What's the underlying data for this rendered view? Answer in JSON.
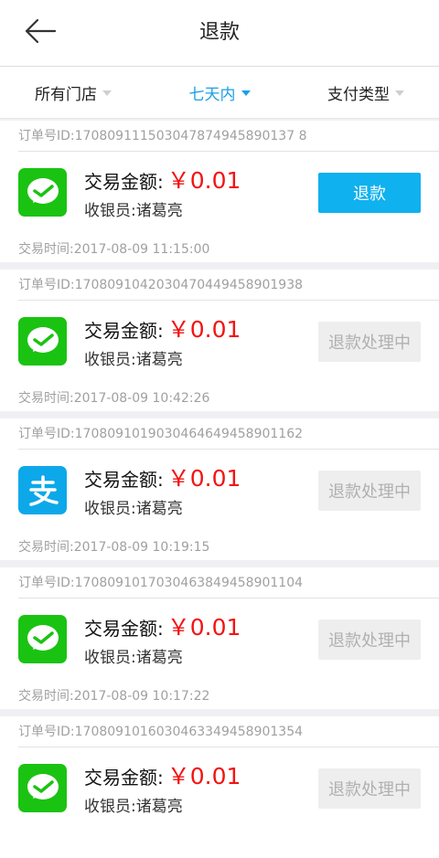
{
  "header": {
    "title": "退款",
    "back_icon": "arrow-left-icon"
  },
  "filters": [
    {
      "label": "所有门店",
      "active": false
    },
    {
      "label": "七天内",
      "active": true
    },
    {
      "label": "支付类型",
      "active": false
    }
  ],
  "labels": {
    "amount_label": "交易金额:",
    "cashier_label": "收银员:",
    "time_label": "交易时间:",
    "order_prefix": "订单号ID:"
  },
  "orders": [
    {
      "order_id": "订单号ID:170809111503047874945890137 8",
      "pay_type": "wechat",
      "pay_icon": "wechat-pay-icon",
      "amount_label": "交易金额:",
      "amount": "￥0.01",
      "cashier": "收银员:诸葛亮",
      "action": "退款",
      "action_state": "refund",
      "time": "交易时间:2017-08-09 11:15:00"
    },
    {
      "order_id": "订单号ID:1708091042030470449458901938",
      "pay_type": "wechat",
      "pay_icon": "wechat-pay-icon",
      "amount_label": "交易金额:",
      "amount": "￥0.01",
      "cashier": "收银员:诸葛亮",
      "action": "退款处理中",
      "action_state": "processing",
      "time": "交易时间:2017-08-09 10:42:26"
    },
    {
      "order_id": "订单号ID:1708091019030464649458901162",
      "pay_type": "alipay",
      "pay_icon": "alipay-icon",
      "amount_label": "交易金额:",
      "amount": "￥0.01",
      "cashier": "收银员:诸葛亮",
      "action": "退款处理中",
      "action_state": "processing",
      "time": "交易时间:2017-08-09 10:19:15"
    },
    {
      "order_id": "订单号ID:1708091017030463849458901104",
      "pay_type": "wechat",
      "pay_icon": "wechat-pay-icon",
      "amount_label": "交易金额:",
      "amount": "￥0.01",
      "cashier": "收银员:诸葛亮",
      "action": "退款处理中",
      "action_state": "processing",
      "time": "交易时间:2017-08-09 10:17:22"
    },
    {
      "order_id": "订单号ID:1708091016030463349458901354",
      "pay_type": "wechat",
      "pay_icon": "wechat-pay-icon",
      "amount_label": "交易金额:",
      "amount": "￥0.01",
      "cashier": "收银员:诸葛亮",
      "action": "退款处理中",
      "action_state": "processing",
      "time": ""
    }
  ],
  "colors": {
    "accent": "#1aa0e6",
    "refund_button": "#0fb1ee",
    "amount": "#f21414",
    "wechat": "#1ac311",
    "alipay": "#0da8ea"
  }
}
